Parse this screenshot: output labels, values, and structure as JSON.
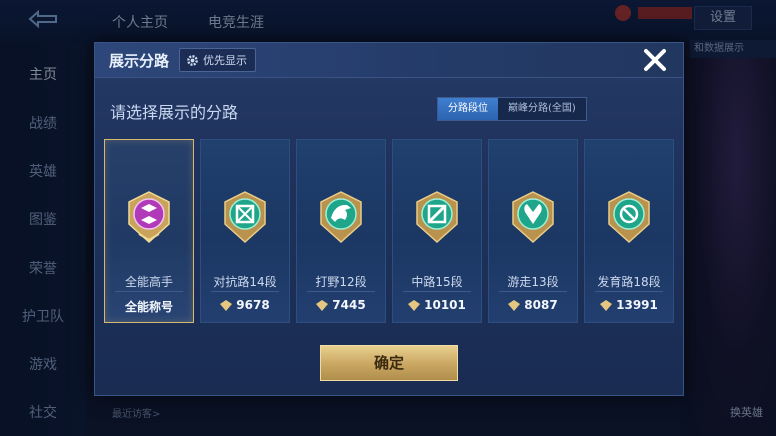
{
  "background": {
    "tabs": [
      "个人主页",
      "电竞生涯"
    ],
    "settings_label": "设置",
    "sidebar": [
      "主页",
      "战绩",
      "英雄",
      "图鉴",
      "荣誉",
      "护卫队",
      "游戏",
      "社交"
    ],
    "recent_visitors": "最近访客>",
    "right_bar_text": "和数据展示",
    "swap_hero": "换英雄"
  },
  "modal": {
    "title": "展示分路",
    "priority_label": "优先显示",
    "subtitle": "请选择展示的分路",
    "toggle": {
      "active": "分路段位",
      "inactive": "巅峰分路(全国)"
    },
    "confirm_label": "确定",
    "cards": [
      {
        "rank": "全能高手",
        "score": "全能称号",
        "icon": "all-round-icon",
        "selected": true
      },
      {
        "rank": "对抗路14段",
        "score": "9678",
        "icon": "clash-lane-icon"
      },
      {
        "rank": "打野12段",
        "score": "7445",
        "icon": "jungle-icon"
      },
      {
        "rank": "中路15段",
        "score": "10101",
        "icon": "mid-lane-icon"
      },
      {
        "rank": "游走13段",
        "score": "8087",
        "icon": "roam-icon"
      },
      {
        "rank": "发育路18段",
        "score": "13991",
        "icon": "farm-lane-icon"
      }
    ]
  },
  "colors": {
    "accent_gold": "#d8b770",
    "emblem_green": "#1fa58a",
    "emblem_purple": "#b03ab8"
  }
}
